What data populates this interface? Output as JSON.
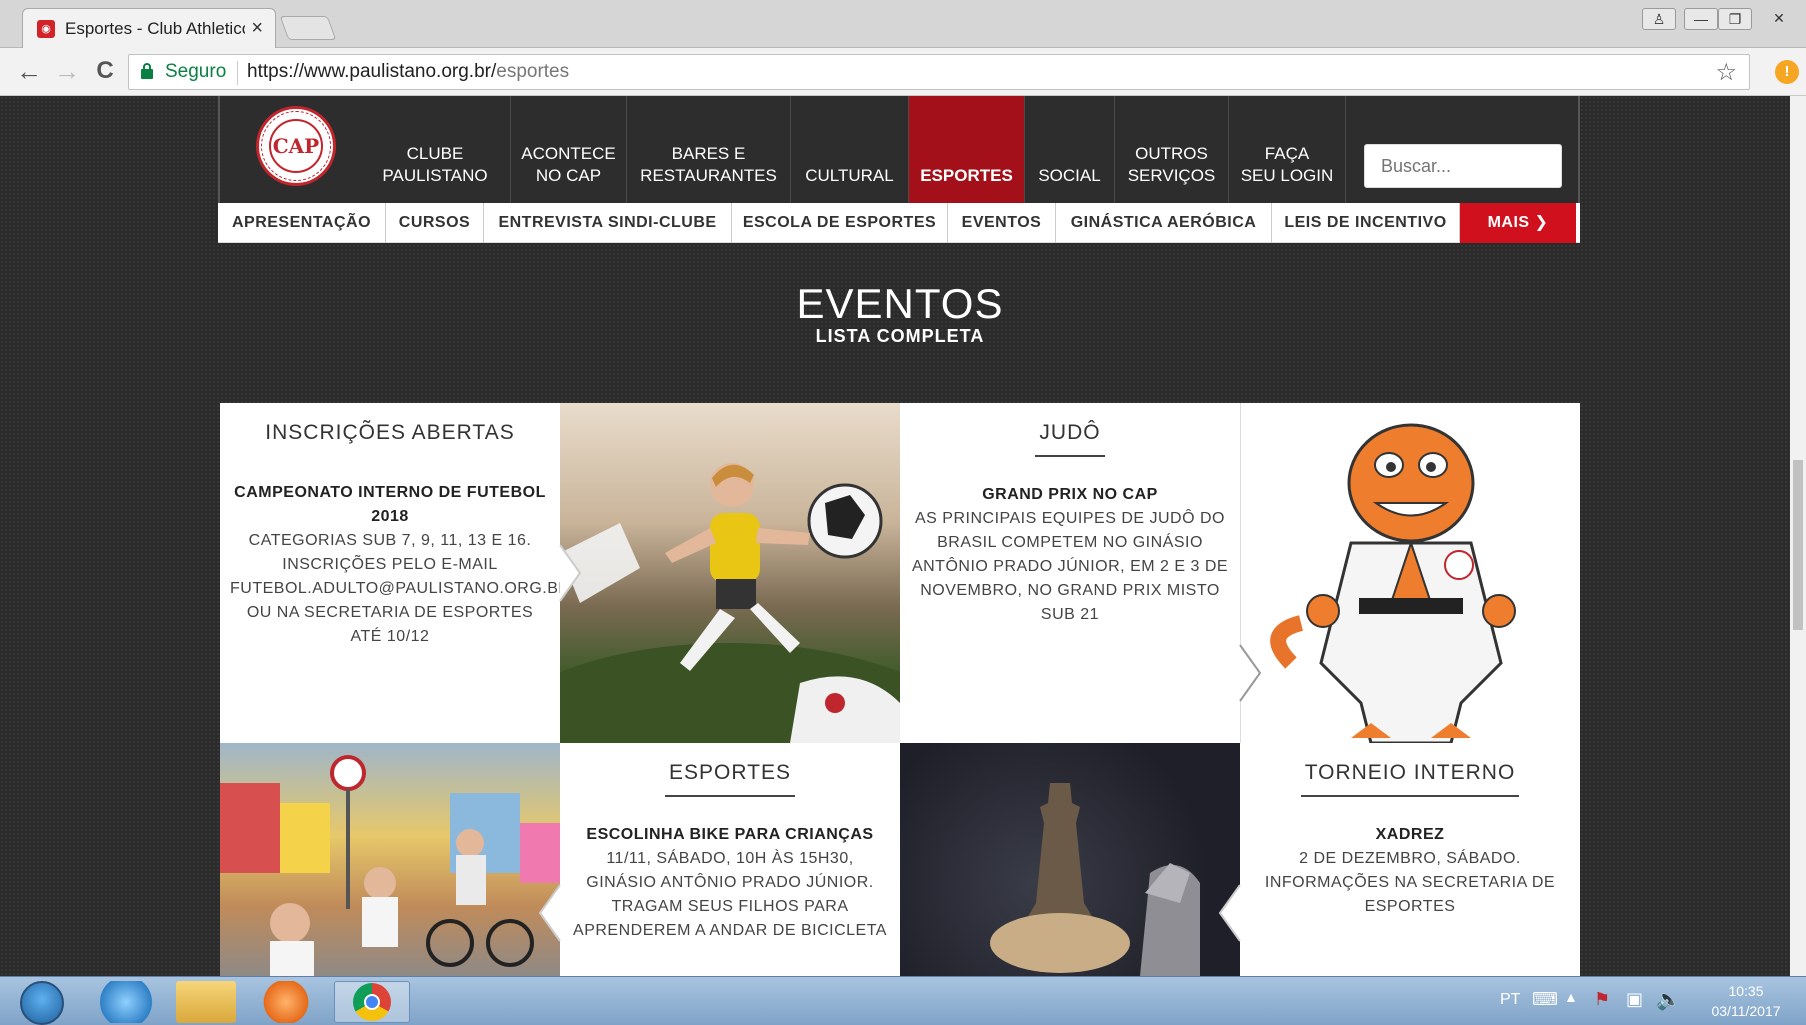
{
  "browser": {
    "tab_title": "Esportes - Club Athletico Paulistano",
    "tab_close": "×",
    "secure_label": "Seguro",
    "url_host": "https://www.paulistano.org.br/",
    "url_path": "esportes",
    "star": "☆",
    "ext_badge": "!",
    "back": "←",
    "forward": "→",
    "reload": "C",
    "win_user": "♙",
    "win_min": "—",
    "win_max": "❐",
    "win_close": "✕"
  },
  "site": {
    "logo_text": "CAP",
    "main_nav": [
      {
        "line1": "CLUBE",
        "line2": "PAULISTANO"
      },
      {
        "line1": "ACONTECE",
        "line2": "NO CAP"
      },
      {
        "line1": "BARES E",
        "line2": "RESTAURANTES"
      },
      {
        "line1": "",
        "line2": "CULTURAL"
      },
      {
        "line1": "",
        "line2": "ESPORTES"
      },
      {
        "line1": "",
        "line2": "SOCIAL"
      },
      {
        "line1": "OUTROS",
        "line2": "SERVIÇOS"
      },
      {
        "line1": "FAÇA",
        "line2": "SEU LOGIN"
      }
    ],
    "search_placeholder": "Buscar...",
    "sub_nav": [
      "APRESENTAÇÃO",
      "CURSOS",
      "ENTREVISTA SINDI-CLUBE",
      "ESCOLA DE ESPORTES",
      "EVENTOS",
      "GINÁSTICA AERÓBICA",
      "LEIS DE INCENTIVO",
      "MAIS ❯"
    ],
    "section_title": "EVENTOS",
    "section_subtitle": "LISTA COMPLETA",
    "cards": [
      {
        "category": "INSCRIÇÕES ABERTAS",
        "heading": "CAMPEONATO INTERNO DE FUTEBOL 2018",
        "text": "CATEGORIAS SUB 7, 9, 11, 13 E 16. INSCRIÇÕES PELO E-MAIL FUTEBOL.ADULTO@PAULISTANO.ORG.BR OU NA SECRETARIA DE ESPORTES ATÉ 10/12"
      },
      {
        "category": "JUDÔ",
        "heading": "GRAND PRIX NO CAP",
        "text": "AS PRINCIPAIS EQUIPES DE JUDÔ DO BRASIL COMPETEM NO GINÁSIO ANTÔNIO PRADO JÚNIOR, EM 2 E 3 DE NOVEMBRO, NO GRAND PRIX MISTO SUB 21"
      },
      {
        "category": "ESPORTES",
        "heading": "ESCOLINHA BIKE PARA CRIANÇAS",
        "text": "11/11, SÁBADO, 10H ÀS 15H30, GINÁSIO ANTÔNIO PRADO JÚNIOR. TRAGAM SEUS FILHOS PARA APRENDEREM A ANDAR DE BICICLETA"
      },
      {
        "category": "TORNEIO INTERNO",
        "heading": "XADREZ",
        "text": "2 DE DEZEMBRO, SÁBADO. INFORMAÇÕES NA SECRETARIA DE ESPORTES"
      }
    ]
  },
  "taskbar": {
    "lang": "PT",
    "time": "10:35",
    "date": "03/11/2017"
  }
}
